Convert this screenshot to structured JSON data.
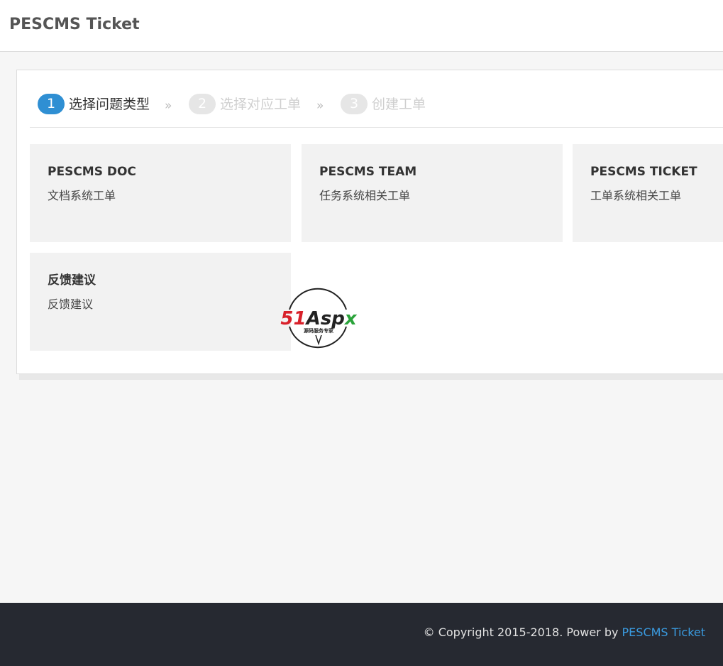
{
  "header": {
    "brand": "PESCMS Ticket"
  },
  "steps": [
    {
      "number": "1",
      "label": "选择问题类型",
      "state": "active"
    },
    {
      "number": "2",
      "label": "选择对应工单",
      "state": "inactive"
    },
    {
      "number": "3",
      "label": "创建工单",
      "state": "inactive"
    }
  ],
  "step_separator": "»",
  "cards": [
    {
      "title": "PESCMS DOC",
      "desc": "文档系统工单"
    },
    {
      "title": "PESCMS TEAM",
      "desc": "任务系统相关工单"
    },
    {
      "title": "PESCMS TICKET",
      "desc": "工单系统相关工单"
    },
    {
      "title": "反馈建议",
      "desc": "反馈建议"
    }
  ],
  "watermark": {
    "logo_text": "51Aspx",
    "tagline": "源码服务专家"
  },
  "footer": {
    "copyright": "© Copyright 2015-2018. Power by ",
    "link_label": "PESCMS Ticket"
  },
  "colors": {
    "accent": "#2f8fd3",
    "inactive_step_bg": "#e6e6e6",
    "inactive_step_text": "#cfcfcf",
    "card_bg": "#f2f2f2",
    "footer_bg": "#262931",
    "footer_link": "#3a9be0"
  }
}
